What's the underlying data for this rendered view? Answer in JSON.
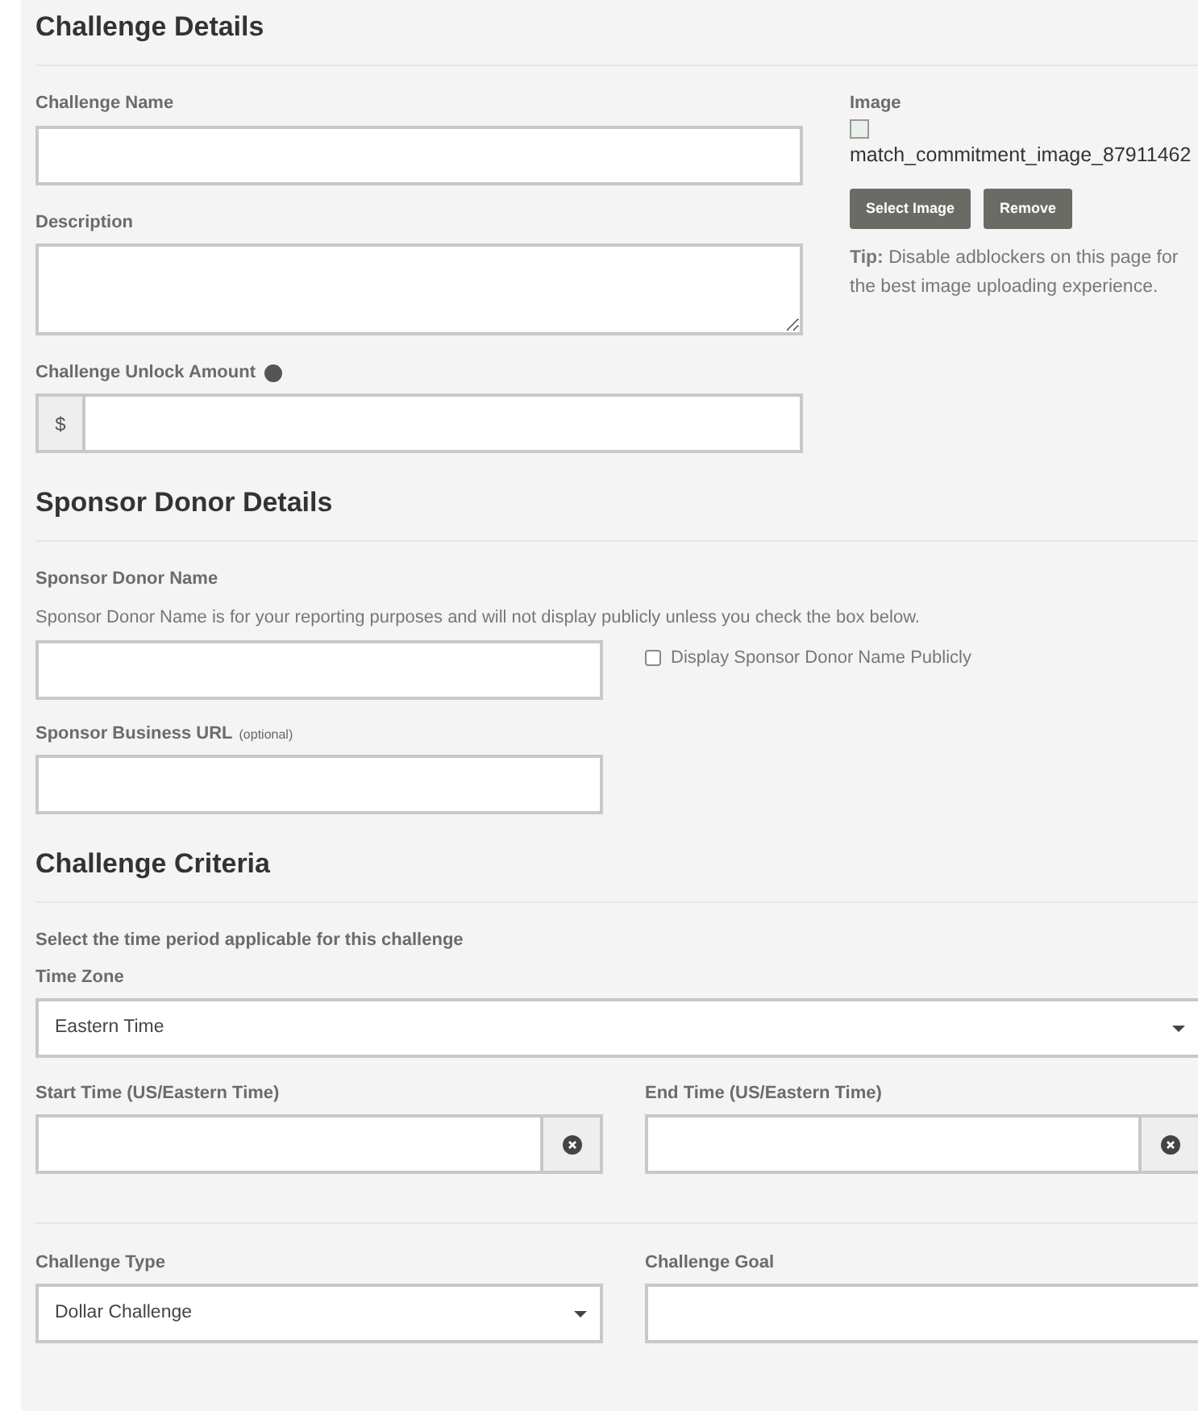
{
  "challenge_details": {
    "title": "Challenge Details",
    "name": {
      "label": "Challenge Name"
    },
    "description": {
      "label": "Description"
    },
    "unlock_amount": {
      "label": "Challenge Unlock Amount",
      "prefix": "$"
    },
    "image": {
      "label": "Image",
      "filename": "match_commitment_image_87911462",
      "buttons": [
        "Select Image",
        "Remove"
      ],
      "tip": "**Tip:** Disable adblockers on this page for the best image uploading experience."
    }
  },
  "sponsor_donor_details": {
    "title": "Sponsor Donor Details",
    "name": {
      "label": "Sponsor Donor Name",
      "help": "Sponsor Donor Name is for your reporting purposes and will not display publicly unless you check the box below."
    },
    "display_publicly": {
      "label": "Display Sponsor Donor Name Publicly",
      "checked": false
    },
    "business_url": {
      "label": "Sponsor Business URL",
      "note": "(optional)"
    }
  },
  "challenge_criteria": {
    "title": "Challenge Criteria",
    "intro": "Select the time period applicable for this challenge",
    "time_zone": {
      "label": "Time Zone",
      "value": "Eastern Time"
    },
    "start_time": {
      "label": "Start Time (US/Eastern Time)"
    },
    "end_time": {
      "label": "End Time (US/Eastern Time)"
    },
    "challenge_type": {
      "label": "Challenge Type",
      "value": "Dollar Challenge"
    },
    "challenge_goal": {
      "label": "Challenge Goal"
    }
  }
}
